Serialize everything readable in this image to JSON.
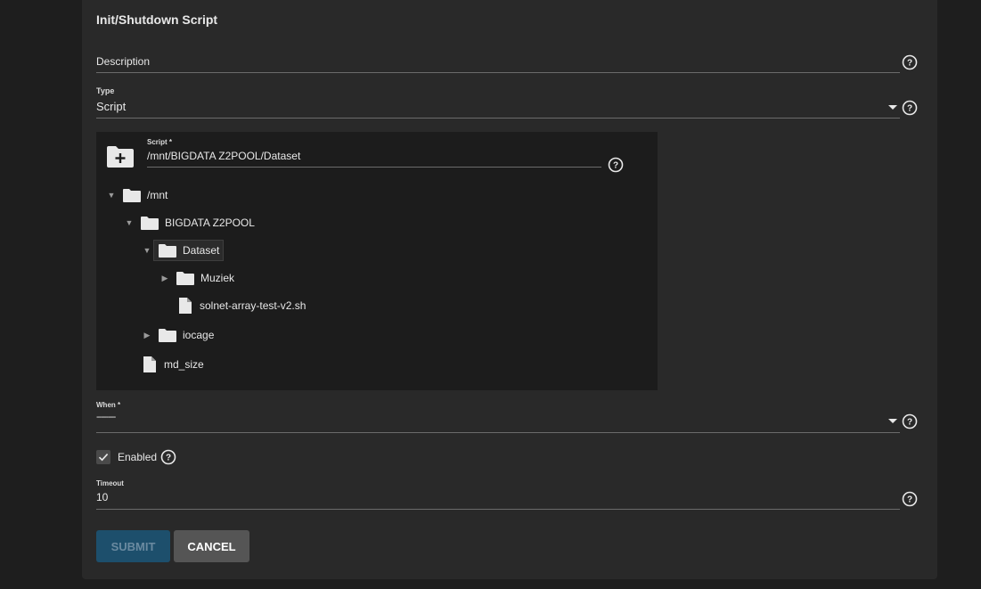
{
  "form": {
    "title": "Init/Shutdown Script",
    "description": {
      "label": "Description",
      "value": ""
    },
    "type": {
      "label": "Type",
      "value": "Script"
    },
    "script": {
      "label": "Script *",
      "value": "/mnt/BIGDATA Z2POOL/Dataset"
    },
    "when": {
      "label": "When *",
      "value": "--------"
    },
    "enabled": {
      "label": "Enabled",
      "checked": true
    },
    "timeout": {
      "label": "Timeout",
      "value": "10"
    }
  },
  "tree": {
    "nodes": [
      {
        "label": "/mnt",
        "kind": "folder",
        "expanded": true
      },
      {
        "label": "BIGDATA Z2POOL",
        "kind": "folder",
        "expanded": true
      },
      {
        "label": "Dataset",
        "kind": "folder",
        "expanded": true,
        "selected": true
      },
      {
        "label": "Muziek",
        "kind": "folder",
        "expanded": false
      },
      {
        "label": "solnet-array-test-v2.sh",
        "kind": "file"
      },
      {
        "label": "iocage",
        "kind": "folder",
        "expanded": false
      },
      {
        "label": "md_size",
        "kind": "file"
      }
    ]
  },
  "buttons": {
    "submit": "SUBMIT",
    "cancel": "CANCEL"
  },
  "colors": {
    "background": "#1e1e1e",
    "card": "#292929",
    "explorer": "#1c1c1c",
    "submit": "#1d4f6c",
    "cancel": "#555555"
  }
}
